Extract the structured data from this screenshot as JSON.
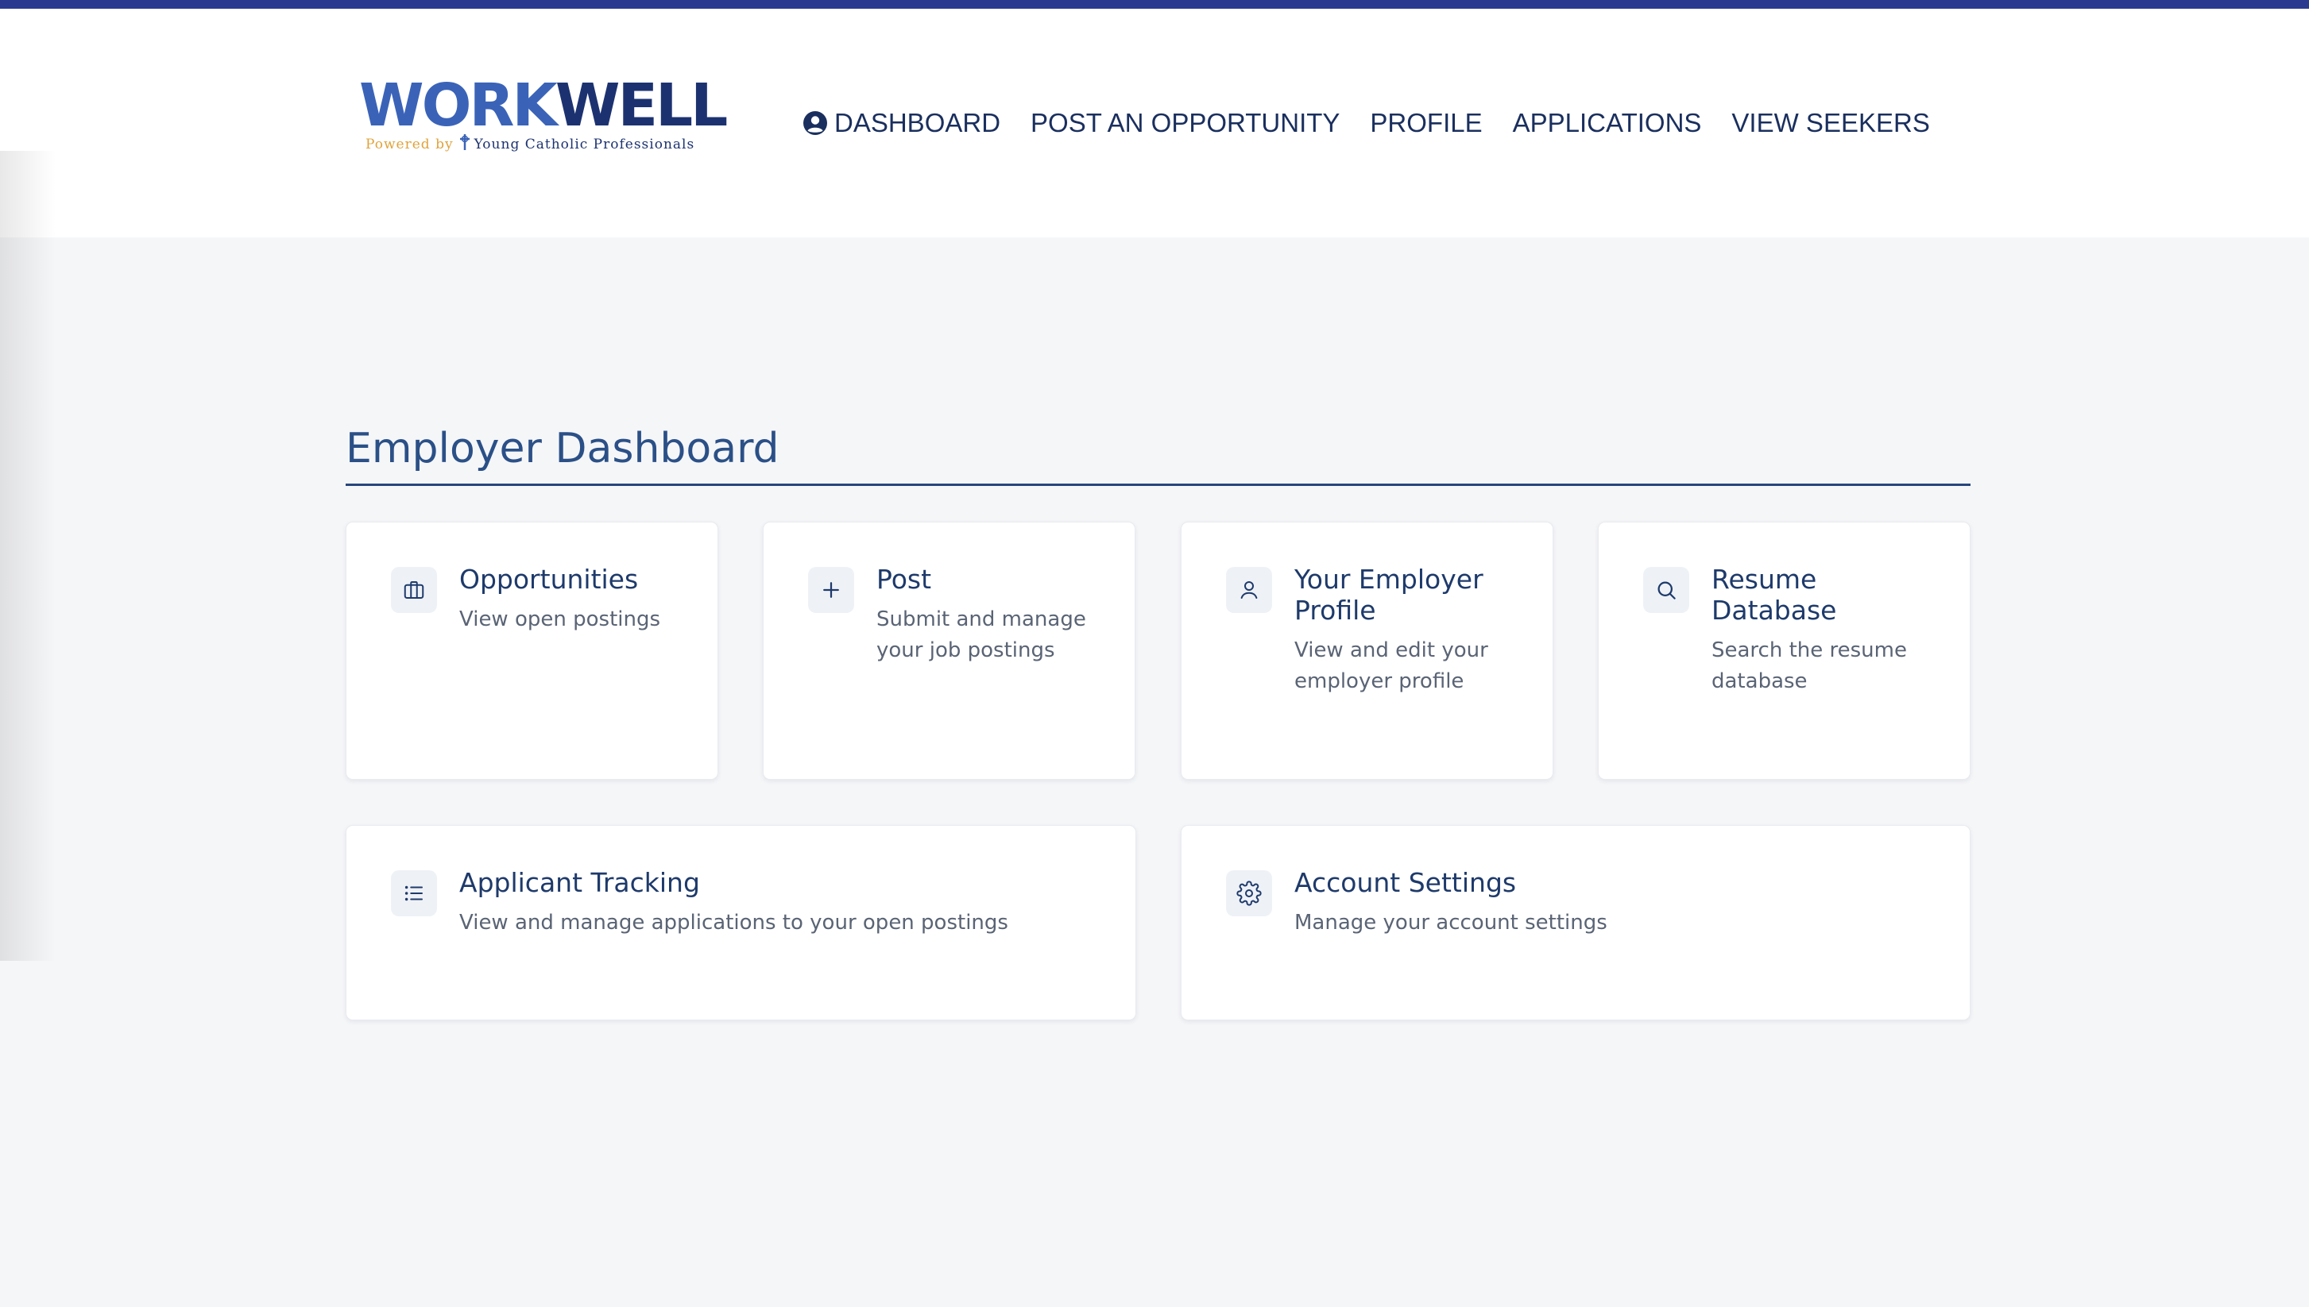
{
  "brand": {
    "word_work": "WORK",
    "word_well": "WELL",
    "powered_by": "Powered by",
    "org": "Young Catholic Professionals",
    "colors": {
      "primary": "#3a63b8",
      "dark": "#1c3270",
      "gold": "#e0a33a",
      "stripe": "#2a3b8f"
    }
  },
  "nav": {
    "items": [
      {
        "label": "DASHBOARD",
        "icon": "user-circle-icon"
      },
      {
        "label": "POST AN OPPORTUNITY"
      },
      {
        "label": "PROFILE"
      },
      {
        "label": "APPLICATIONS"
      },
      {
        "label": "VIEW SEEKERS"
      }
    ]
  },
  "page": {
    "title": "Employer Dashboard"
  },
  "cards": [
    {
      "title": "Opportunities",
      "desc": "View open postings",
      "icon": "briefcase-icon"
    },
    {
      "title": "Post",
      "desc": "Submit and manage your job postings",
      "icon": "plus-icon"
    },
    {
      "title": "Your Employer Profile",
      "desc": "View and edit your employer profile",
      "icon": "user-icon"
    },
    {
      "title": "Resume Database",
      "desc": "Search the resume database",
      "icon": "search-icon"
    },
    {
      "title": "Applicant Tracking",
      "desc": "View and manage applications to your open postings",
      "icon": "list-icon"
    },
    {
      "title": "Account Settings",
      "desc": "Manage your account settings",
      "icon": "gear-icon"
    }
  ]
}
